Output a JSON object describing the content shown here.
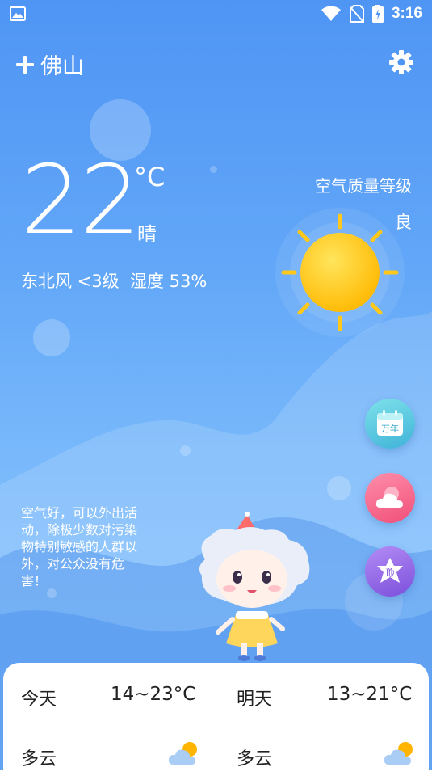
{
  "status_bar": {
    "time": "3:16",
    "icons": [
      "image-icon",
      "wifi-icon",
      "no-sim-icon",
      "battery-charging-icon"
    ]
  },
  "header": {
    "add_icon": "plus-icon",
    "city": "佛山",
    "settings_icon": "gear-icon"
  },
  "current": {
    "temperature": "22",
    "unit": "°C",
    "condition": "晴",
    "wind_humidity": "东北风 <3级  湿度 53%",
    "weather_icon": "sun-icon"
  },
  "air_quality": {
    "label": "空气质量等级",
    "value": "良"
  },
  "side_buttons": [
    {
      "name": "calendar-button",
      "label": "万年",
      "icon": "calendar-icon"
    },
    {
      "name": "weather-detail-button",
      "icon": "cloud-sun-icon"
    },
    {
      "name": "horoscope-button",
      "label": "♍",
      "icon": "virgo-star-icon"
    }
  ],
  "advice": "空气好，可以外出活\n动，除极少数对污染\n物特别敏感的人群以\n外，对公众没有危\n害！",
  "forecast": [
    {
      "day": "今天",
      "range": "14~23°C",
      "condition": "多云",
      "icon": "partly-cloudy-icon"
    },
    {
      "day": "明天",
      "range": "13~21°C",
      "condition": "多云",
      "icon": "partly-cloudy-icon"
    }
  ],
  "colors": {
    "sky_top": "#4f95f4",
    "sky_bottom": "#8cc7fd",
    "sun": "#ffc81a",
    "card": "#ffffff"
  }
}
